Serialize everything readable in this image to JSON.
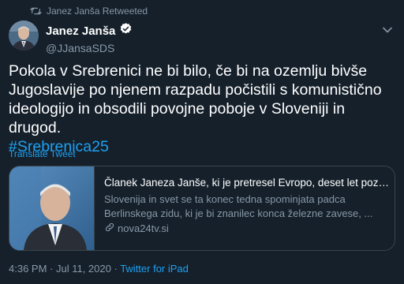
{
  "retweet": {
    "text": "Janez Janša Retweeted",
    "icon": "retweet-icon"
  },
  "author": {
    "name": "Janez Janša",
    "handle": "@JJansaSDS",
    "verified": true,
    "verified_icon": "verified-badge-icon"
  },
  "tweet": {
    "text": "Pokola v Srebrenici ne bi bilo, če bi na ozemlju bivše\nJugoslavije po njenem razpadu počistili s komunistično\nideologijo in obsodili povojne poboje v Sloveniji in drugod.",
    "hashtag": "#Srebrenica25",
    "translate_label": "Translate Tweet"
  },
  "card": {
    "title": "Članek Janeza Janše, ki je pretresel Evropo, deset let pozn...",
    "description": "Slovenija in svet se ta konec tedna spominjata padca\nBerlinskega zidu, ki je bi znanilec konca železne zavese, ...",
    "domain": "nova24tv.si",
    "link_icon": "link-icon"
  },
  "meta": {
    "time": "4:36 PM",
    "separator": " · ",
    "date": "Jul 11, 2020",
    "source": "Twitter for iPad"
  },
  "colors": {
    "background": "#15202b",
    "accent": "#1da1f2",
    "muted": "#8899a6",
    "border": "#38444d"
  }
}
